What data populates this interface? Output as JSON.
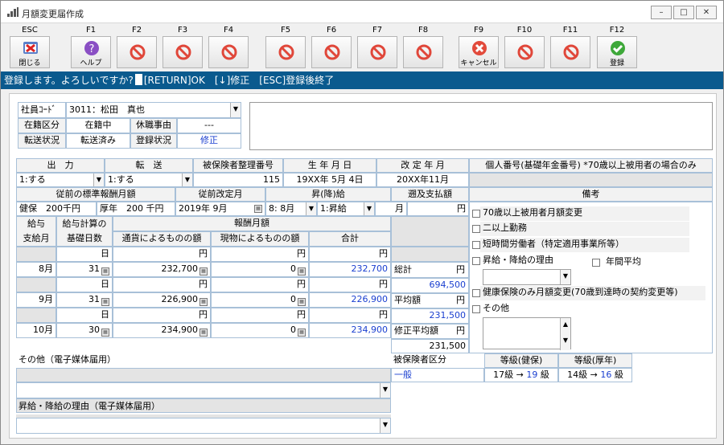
{
  "window": {
    "title": "月額変更届作成"
  },
  "toolbar": [
    {
      "key": "ESC",
      "label": "閉じる",
      "icon": "close-icon"
    },
    {
      "key": "F1",
      "label": "ヘルプ",
      "icon": "help-icon"
    },
    {
      "key": "F2",
      "label": "",
      "icon": "disabled-icon"
    },
    {
      "key": "F3",
      "label": "",
      "icon": "disabled-icon"
    },
    {
      "key": "F4",
      "label": "",
      "icon": "disabled-icon"
    },
    {
      "key": "F5",
      "label": "",
      "icon": "disabled-icon"
    },
    {
      "key": "F6",
      "label": "",
      "icon": "disabled-icon"
    },
    {
      "key": "F7",
      "label": "",
      "icon": "disabled-icon"
    },
    {
      "key": "F8",
      "label": "",
      "icon": "disabled-icon"
    },
    {
      "key": "F9",
      "label": "キャンセル",
      "icon": "cancel-icon"
    },
    {
      "key": "F10",
      "label": "",
      "icon": "disabled-icon"
    },
    {
      "key": "F11",
      "label": "",
      "icon": "disabled-icon"
    },
    {
      "key": "F12",
      "label": "登録",
      "icon": "checkmark-icon"
    }
  ],
  "message": {
    "prompt": "登録します。よろしいですか?",
    "keys": "[RETURN]OK　[↓]修正　[ESC]登録後終了"
  },
  "employee": {
    "label": "社員ｺｰﾄﾞ",
    "value": "3011：松田　真也"
  },
  "status": {
    "enroll_label": "在籍区分",
    "enroll_value": "在籍中",
    "leave_label": "休職事由",
    "leave_value": "---",
    "transfer_label": "転送状況",
    "transfer_value": "転送済み",
    "reg_label": "登録状況",
    "reg_value": "修正"
  },
  "hdr1": {
    "output": "出　力",
    "transfer": "転　送",
    "insured_no": "被保険者整理番号",
    "birth": "生 年 月 日",
    "revision": "改 定 年 月",
    "mynumber": "個人番号(基礎年金番号) *70歳以上被用者の場合のみ"
  },
  "row1": {
    "output": "1:する",
    "transfer": "1:する",
    "insured_no": "115",
    "birth": "19XX年 5月 4日",
    "revision": "20XX年11月"
  },
  "hdr2": {
    "prev_std": "従前の標準報酬月額",
    "prev_rev": "従前改定月",
    "raise": "昇(降)給",
    "retro": "遡及支払額",
    "remarks": "備考"
  },
  "row2": {
    "health_label": "健保",
    "health_value": "200千円",
    "pension_label": "厚年",
    "pension_value": "200 千円",
    "prev_rev": "2019年 9月",
    "raise_month": "8: 8月",
    "raise_type": "1:昇給",
    "retro_month": "月",
    "retro_yen": "円"
  },
  "hdr3": {
    "pay_month_1": "給与",
    "pay_month_2": "支給月",
    "days_1": "給与計算の",
    "days_2": "基礎日数",
    "monthly": "報酬月額",
    "currency": "通貨によるものの額",
    "kind": "現物によるものの額",
    "total": "合計"
  },
  "units": {
    "day": "日",
    "yen": "円"
  },
  "months": [
    {
      "month": "8月",
      "days": "31",
      "currency": "232,700",
      "kind": "0",
      "total": "232,700"
    },
    {
      "month": "9月",
      "days": "31",
      "currency": "226,900",
      "kind": "0",
      "total": "226,900"
    },
    {
      "month": "10月",
      "days": "30",
      "currency": "234,900",
      "kind": "0",
      "total": "234,900"
    }
  ],
  "summary": {
    "sum_label": "総計",
    "sum_value": "694,500",
    "avg_label": "平均額",
    "avg_value": "231,500",
    "mod_label": "修正平均額",
    "mod_value": "231,500",
    "yen": "円"
  },
  "remarks_checks": [
    "70歳以上被用者月額変更",
    "二以上勤務",
    "短時間労働者（特定適用事業所等）",
    "昇給・降給の理由",
    "健康保険のみ月額変更(70歳到達時の契約変更等)",
    "その他"
  ],
  "annual_avg": "年間平均",
  "other_media": {
    "label": "その他（電子媒体届用）"
  },
  "raise_reason_media": {
    "label": "昇給・降給の理由（電子媒体届用）"
  },
  "grade": {
    "class_label": "被保険者区分",
    "health_label": "等級(健保)",
    "pension_label": "等級(厚年)",
    "class_value": "一般",
    "health_from": "17級",
    "health_to": "19",
    "pension_from": "14級",
    "pension_to": "16",
    "arrow": "→",
    "unit": "級"
  }
}
